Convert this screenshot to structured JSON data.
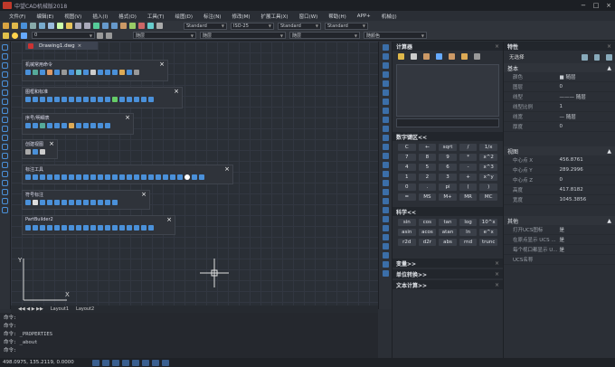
{
  "app": {
    "title": "中望CAD机械版2018"
  },
  "menu": [
    "文件(F)",
    "编辑(E)",
    "视图(V)",
    "插入(I)",
    "格式(O)",
    "工具(T)",
    "绘图(D)",
    "标注(N)",
    "修改(M)",
    "扩展工具(X)",
    "窗口(W)",
    "帮助(H)",
    "APP+",
    "机械(J)"
  ],
  "toolbar": {
    "style1": "Standard",
    "style2": "ISO-25",
    "style3": "Standard",
    "style4": "Standard",
    "layer": "0",
    "linetype1": "随层",
    "linetype2": "随层",
    "linetype3": "随层",
    "color": "随颜色"
  },
  "doc": {
    "tab": "Drawing1.dwg"
  },
  "panels": [
    {
      "title": "机械常用命令"
    },
    {
      "title": "图框和标准"
    },
    {
      "title": "序号/明细表"
    },
    {
      "title": "创建视图"
    },
    {
      "title": "标注工具"
    },
    {
      "title": "符号标注"
    },
    {
      "title": "PartBuilder2"
    }
  ],
  "layouts": [
    "Layout1",
    "Layout2"
  ],
  "calculator": {
    "title": "计算器",
    "number_pad_title": "数字键区<<",
    "number_keys": [
      "C",
      "←",
      "sqrt",
      "/",
      "1/x",
      "7",
      "8",
      "9",
      "*",
      "x^2",
      "4",
      "5",
      "6",
      "-",
      "x^3",
      "1",
      "2",
      "3",
      "+",
      "x^y",
      "0",
      ".",
      "pi",
      "(",
      ")",
      "=",
      "MS",
      "M+",
      "MR",
      "MC"
    ],
    "sci_title": "科学<<",
    "sci_keys": [
      "sin",
      "cos",
      "tan",
      "log",
      "10^x",
      "asin",
      "acos",
      "atan",
      "ln",
      "e^x",
      "r2d",
      "d2r",
      "abs",
      "rnd",
      "trunc"
    ],
    "variables_title": "变量>>",
    "unit_title": "单位转换>>",
    "text_title": "文本计算>>"
  },
  "properties": {
    "title": "特性",
    "selection": "无选择",
    "basic_title": "基本",
    "basic": [
      {
        "k": "颜色",
        "v": "■ 随层"
      },
      {
        "k": "图层",
        "v": "0"
      },
      {
        "k": "线型",
        "v": "——— 随层"
      },
      {
        "k": "线型比例",
        "v": "1"
      },
      {
        "k": "线宽",
        "v": "— 随层"
      },
      {
        "k": "厚度",
        "v": "0"
      }
    ],
    "view_title": "视图",
    "view": [
      {
        "k": "中心点 X",
        "v": "456.8761"
      },
      {
        "k": "中心点 Y",
        "v": "289.2996"
      },
      {
        "k": "中心点 Z",
        "v": "0"
      },
      {
        "k": "高度",
        "v": "417.8182"
      },
      {
        "k": "宽度",
        "v": "1045.3856"
      }
    ],
    "misc_title": "其他",
    "misc": [
      {
        "k": "打开UCS图标",
        "v": "是"
      },
      {
        "k": "在原点显示 UCS ...",
        "v": "是"
      },
      {
        "k": "每个视口都显示 U...",
        "v": "是"
      },
      {
        "k": "UCS名称",
        "v": ""
      }
    ]
  },
  "command": {
    "lines": [
      "命令:",
      "命令:",
      "命令: _PROPERTIES",
      "命令: _about",
      "命令:"
    ]
  },
  "status": {
    "coords": "498.0975, 135.2119, 0.0000"
  },
  "colors": {
    "accent": "#4a90d9",
    "bg": "#2b2f36"
  }
}
